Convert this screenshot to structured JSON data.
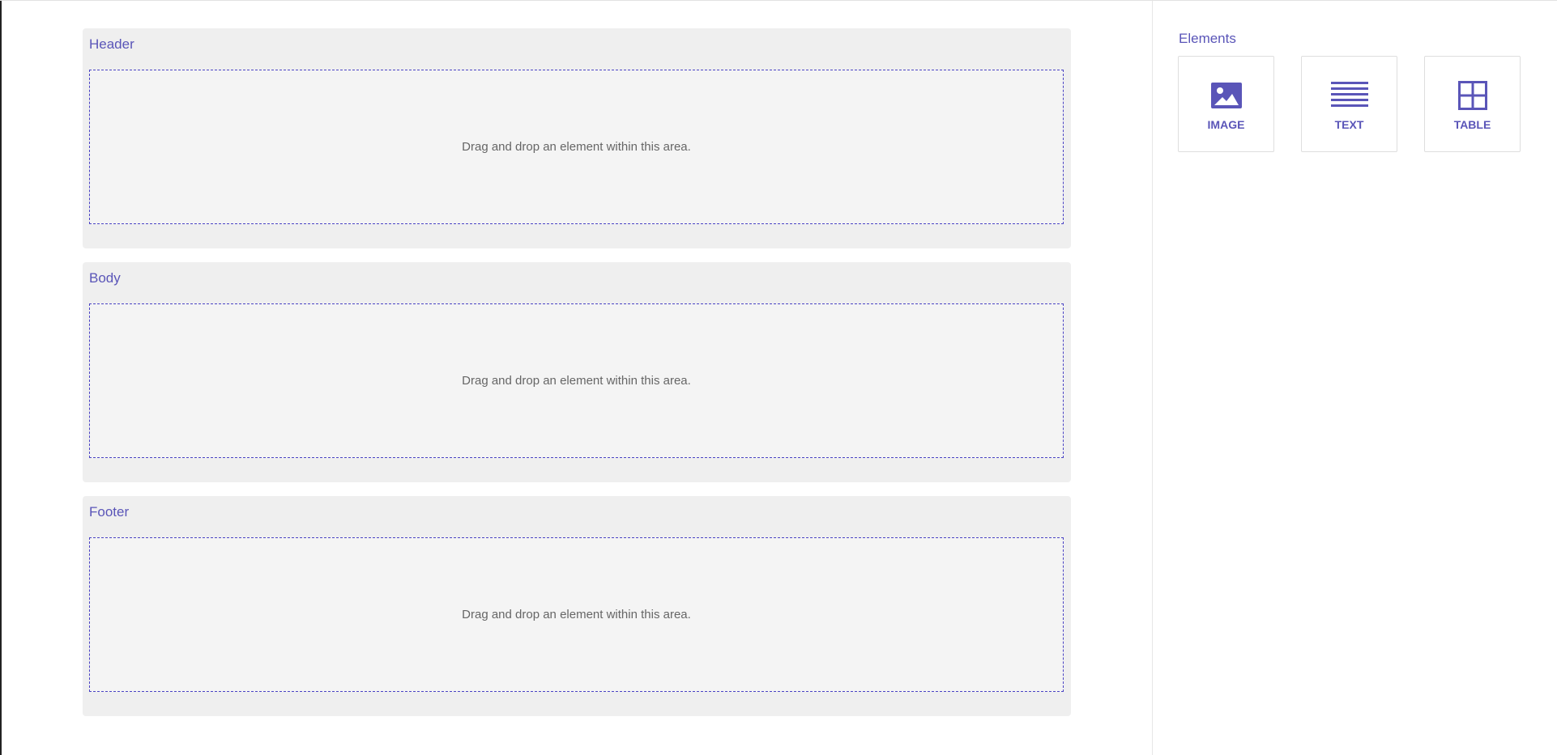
{
  "sections": [
    {
      "title": "Header",
      "placeholder": "Drag and drop an element within this area."
    },
    {
      "title": "Body",
      "placeholder": "Drag and drop an element within this area."
    },
    {
      "title": "Footer",
      "placeholder": "Drag and drop an element within this area."
    }
  ],
  "sidebar": {
    "title": "Elements",
    "items": [
      {
        "label": "IMAGE",
        "icon": "image-icon"
      },
      {
        "label": "TEXT",
        "icon": "text-lines-icon"
      },
      {
        "label": "TABLE",
        "icon": "table-grid-icon"
      }
    ]
  },
  "colors": {
    "accent": "#5a55b8",
    "dropzone_border": "#4a43c4",
    "section_bg": "#efefef"
  }
}
